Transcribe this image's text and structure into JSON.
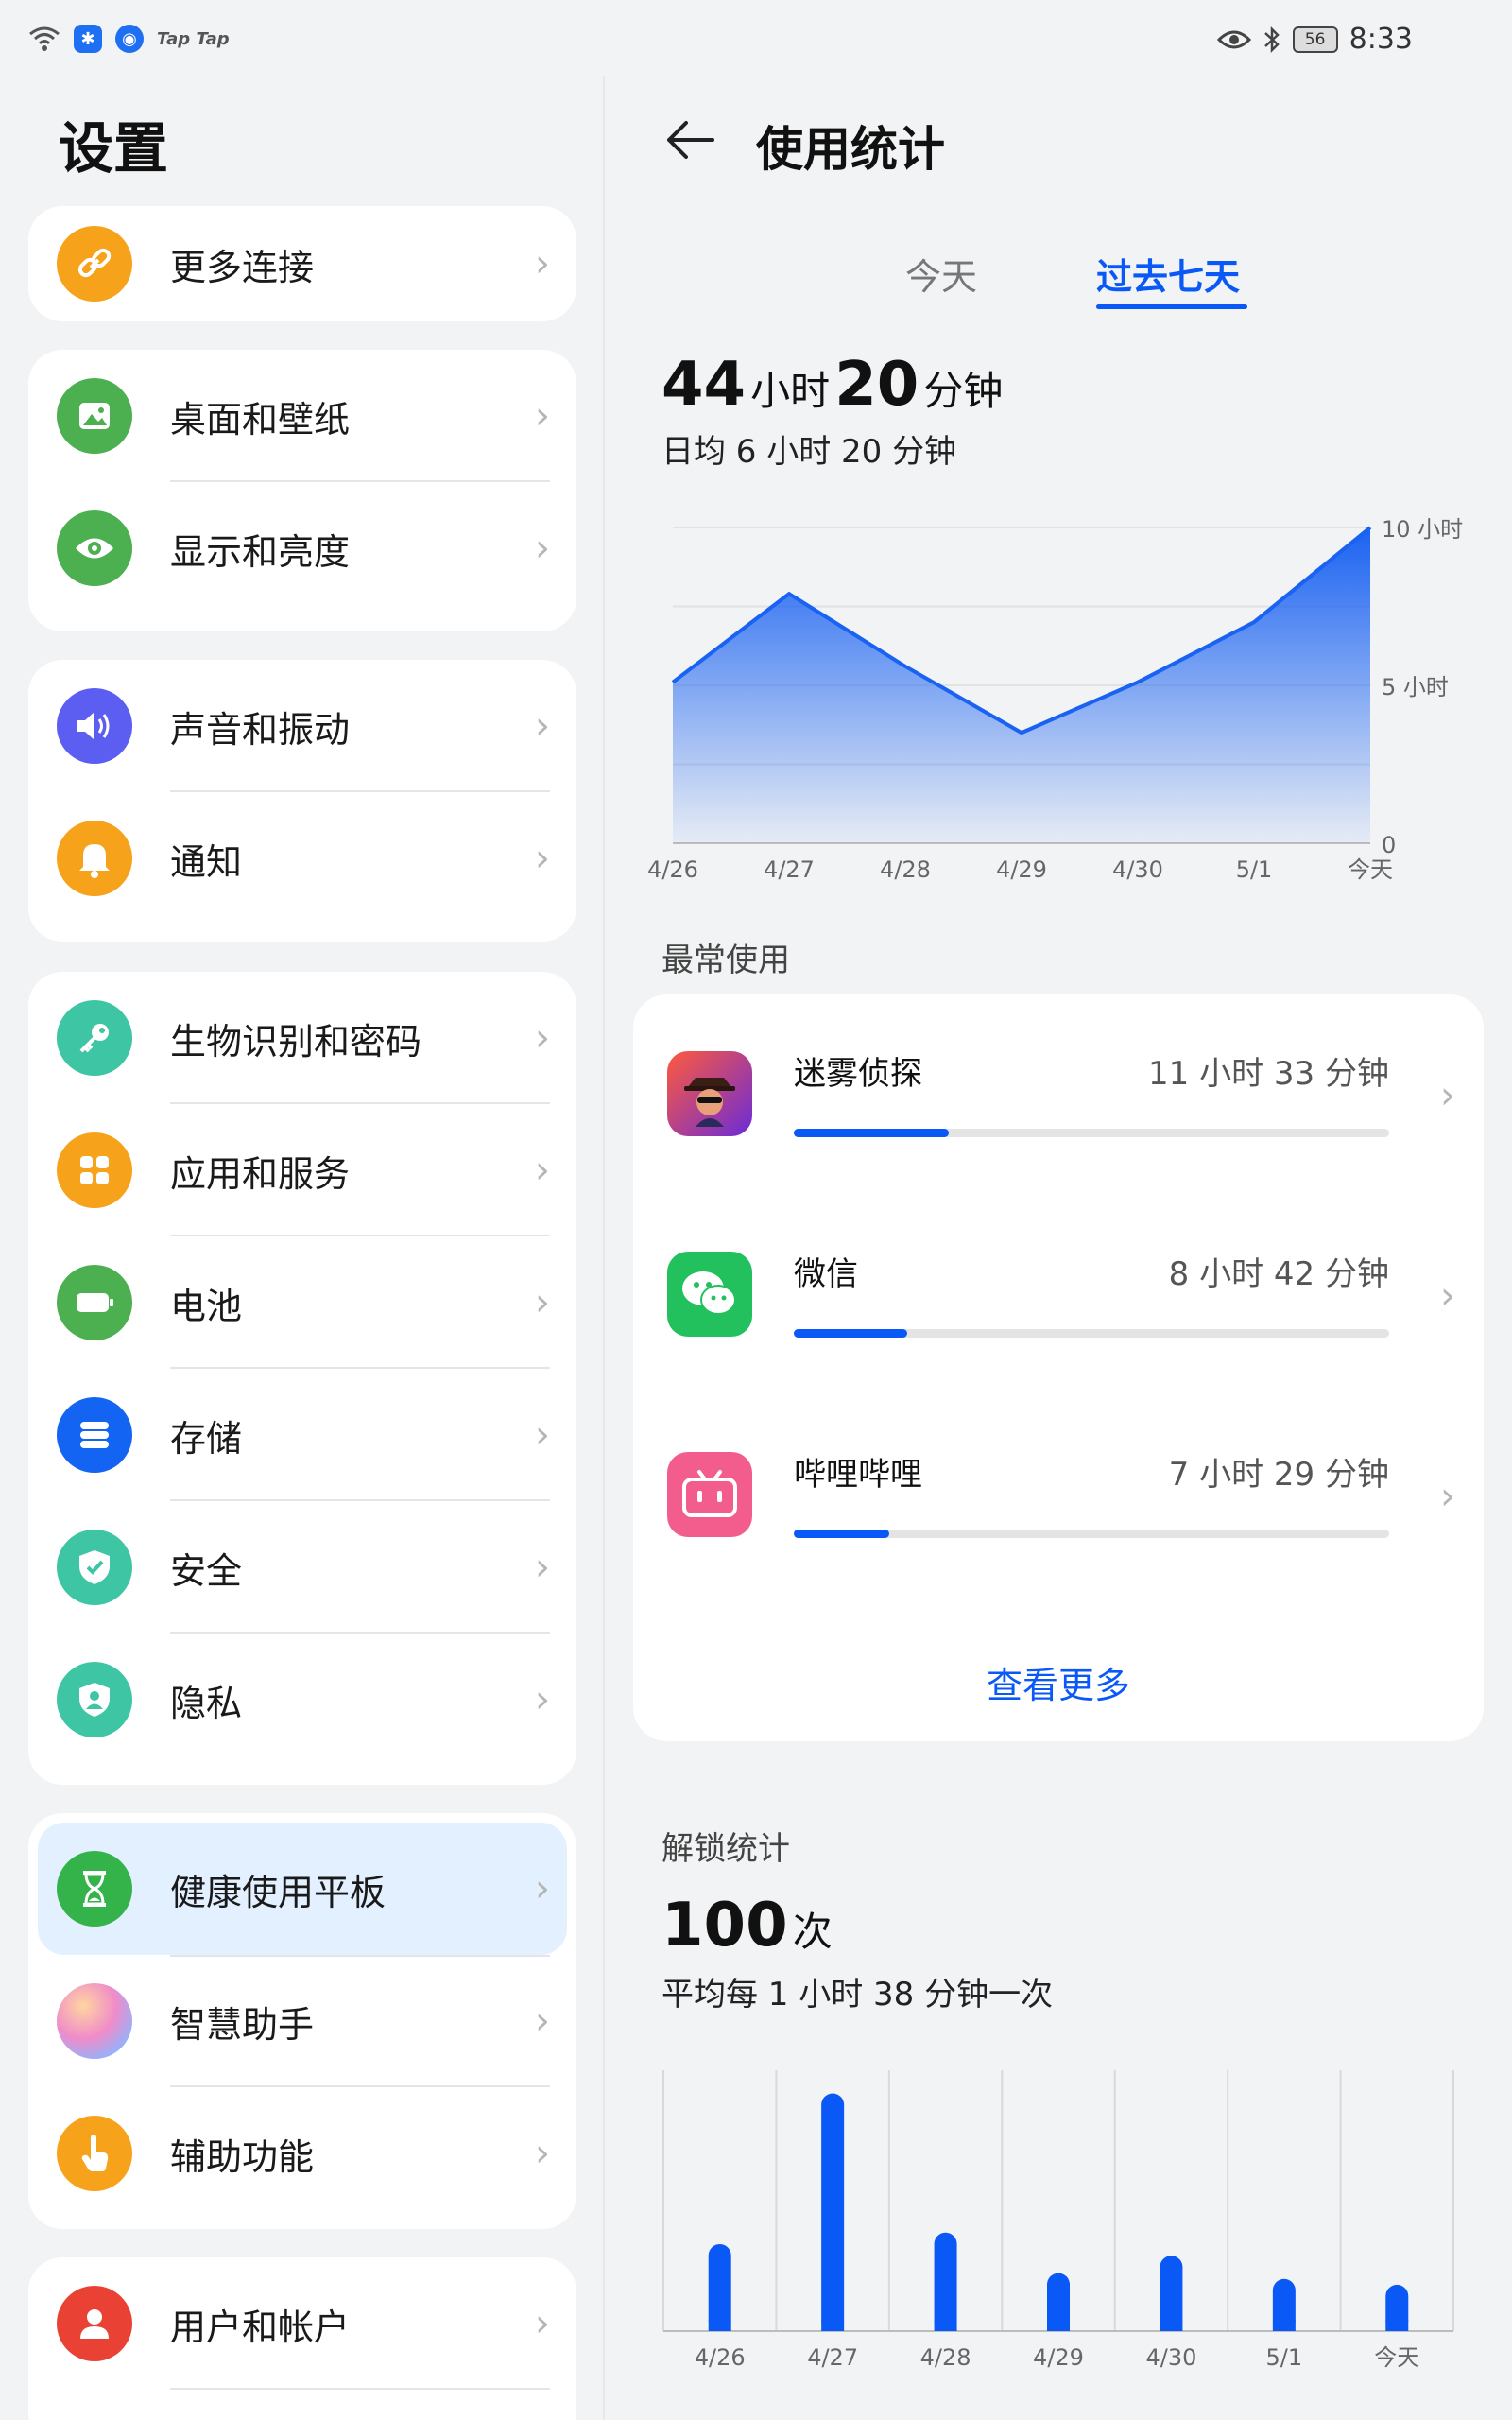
{
  "status_bar": {
    "left_text": "Tap Tap",
    "battery": "56",
    "time": "8:33"
  },
  "settings": {
    "title": "设置",
    "groups": [
      {
        "items": [
          {
            "label": "更多连接",
            "icon": "link-icon",
            "color": "#f7a21b"
          }
        ]
      },
      {
        "items": [
          {
            "label": "桌面和壁纸",
            "icon": "image-icon",
            "color": "#4caf50"
          },
          {
            "label": "显示和亮度",
            "icon": "eye-icon",
            "color": "#4caf50"
          }
        ]
      },
      {
        "items": [
          {
            "label": "声音和振动",
            "icon": "speaker-icon",
            "color": "#5b5ef0"
          },
          {
            "label": "通知",
            "icon": "bell-icon",
            "color": "#f7a21b"
          }
        ]
      },
      {
        "items": [
          {
            "label": "生物识别和密码",
            "icon": "key-icon",
            "color": "#3ec5a4"
          },
          {
            "label": "应用和服务",
            "icon": "apps-grid-icon",
            "color": "#f7a21b"
          },
          {
            "label": "电池",
            "icon": "battery-icon",
            "color": "#4caf50"
          },
          {
            "label": "存储",
            "icon": "storage-icon",
            "color": "#1464f4"
          },
          {
            "label": "安全",
            "icon": "shield-icon",
            "color": "#3ec5a4"
          },
          {
            "label": "隐私",
            "icon": "privacy-shield-icon",
            "color": "#3ec5a4"
          }
        ]
      },
      {
        "items": [
          {
            "label": "健康使用平板",
            "icon": "hourglass-icon",
            "color": "#34b34a",
            "active": true
          },
          {
            "label": "智慧助手",
            "icon": "assistant-orb-icon",
            "color": "#c08cf0"
          },
          {
            "label": "辅助功能",
            "icon": "hand-pointer-icon",
            "color": "#f7a21b"
          }
        ]
      },
      {
        "items": [
          {
            "label": "用户和帐户",
            "icon": "user-icon",
            "color": "#e94235"
          }
        ]
      }
    ]
  },
  "usage": {
    "title": "使用统计",
    "tabs": [
      "今天",
      "过去七天"
    ],
    "total_hours": "44",
    "hour_unit": "小时",
    "total_minutes": "20",
    "minute_unit": "分钟",
    "daily_avg": "日均 6 小时 20 分钟",
    "most_used_label": "最常使用",
    "apps": [
      {
        "name": "迷雾侦探",
        "time": "11 小时 33 分钟",
        "fraction": 0.26,
        "icon": "detective-game-icon"
      },
      {
        "name": "微信",
        "time": "8 小时 42 分钟",
        "fraction": 0.19,
        "icon": "wechat-icon"
      },
      {
        "name": "哔哩哔哩",
        "time": "7 小时 29 分钟",
        "fraction": 0.16,
        "icon": "bilibili-icon"
      }
    ],
    "see_more": "查看更多",
    "unlock_label": "解锁统计",
    "unlock_count": "100",
    "unlock_unit": "次",
    "unlock_avg": "平均每 1 小时 38 分钟一次"
  },
  "chart_data": [
    {
      "type": "area",
      "categories": [
        "4/26",
        "4/27",
        "4/28",
        "4/29",
        "4/30",
        "5/1",
        "今天"
      ],
      "values": [
        5.1,
        7.9,
        5.6,
        3.5,
        5.1,
        7.0,
        10.0
      ],
      "y_ticks": [
        "0",
        "5 小时",
        "10 小时"
      ],
      "ylim": [
        0,
        10
      ],
      "color": "#1a62f2"
    },
    {
      "type": "bar",
      "categories": [
        "4/26",
        "4/27",
        "4/28",
        "4/29",
        "4/30",
        "5/1",
        "今天"
      ],
      "values": [
        15,
        41,
        17,
        10,
        13,
        9,
        8
      ],
      "ylim": [
        0,
        45
      ],
      "color": "#0a59f7"
    }
  ]
}
